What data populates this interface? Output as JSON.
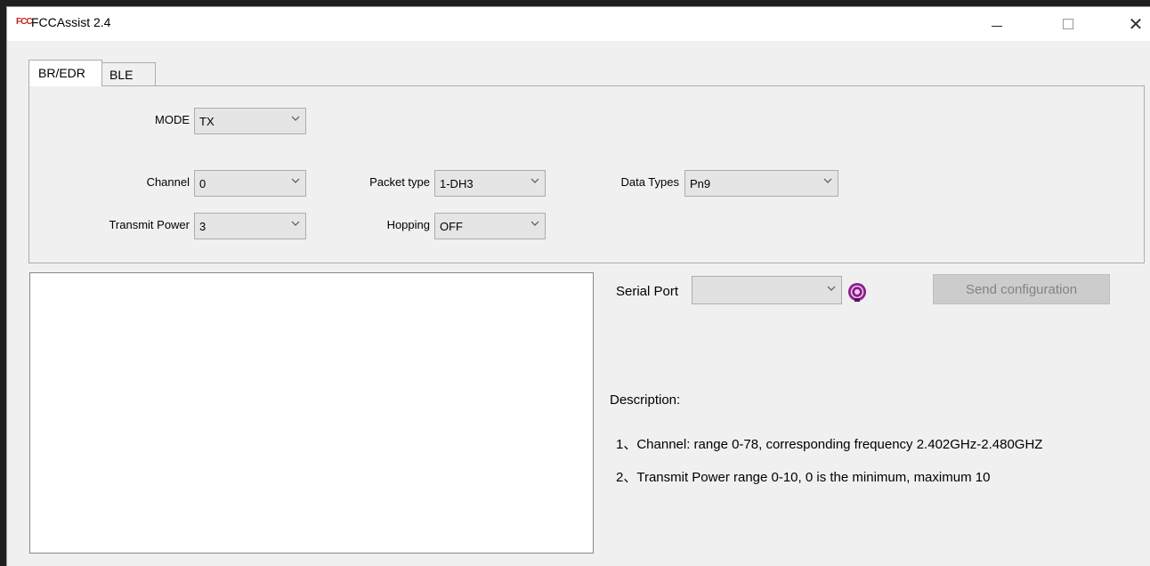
{
  "window": {
    "app_icon_text": "FCC",
    "title": "FCCAssist 2.4",
    "minimize_icon": "minimize-icon",
    "maximize_icon": "maximize-icon",
    "close_icon": "close-icon"
  },
  "tabs": [
    {
      "label": "BR/EDR",
      "active": true
    },
    {
      "label": "BLE",
      "active": false
    }
  ],
  "config": {
    "mode": {
      "label": "MODE",
      "value": "TX"
    },
    "channel": {
      "label": "Channel",
      "value": "0"
    },
    "transmit_power": {
      "label": "Transmit Power",
      "value": "3"
    },
    "packet_type": {
      "label": "Packet type",
      "value": "1-DH3"
    },
    "hopping": {
      "label": "Hopping",
      "value": "OFF"
    },
    "data_types": {
      "label": "Data Types",
      "value": "Pn9"
    }
  },
  "serial": {
    "label": "Serial Port",
    "value": "",
    "status_icon": "serial-status-icon",
    "status_color": "#8a1c8a"
  },
  "send_button": {
    "label": "Send configuration",
    "enabled": false
  },
  "description": {
    "heading": "Description:",
    "lines": [
      "1、Channel: range 0-78, corresponding frequency 2.402GHz-2.480GHZ",
      "2、Transmit Power  range 0-10, 0 is the minimum, maximum 10"
    ]
  },
  "log": {
    "text": ""
  }
}
